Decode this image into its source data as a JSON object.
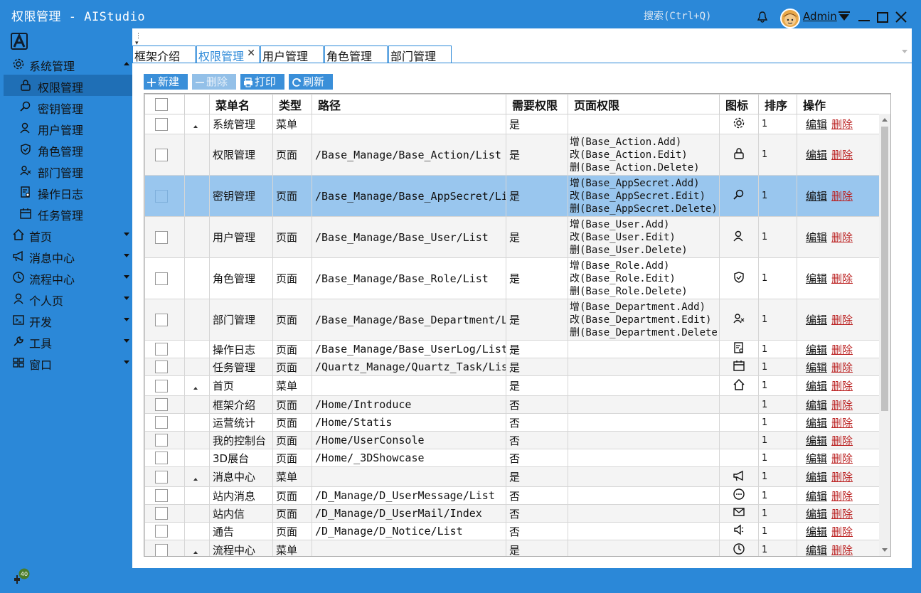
{
  "window": {
    "title": "权限管理 - AIStudio",
    "search_placeholder": "搜索(Ctrl+Q)",
    "user": "Admin",
    "notify_badge": "40"
  },
  "colors": {
    "accent": "#2b88d8",
    "selected_row": "#99c6ee",
    "delete_link": "#b22222"
  },
  "sidebar": {
    "groups": [
      {
        "label": "系统管理",
        "icon": "gear-icon",
        "expanded": true,
        "items": [
          {
            "label": "权限管理",
            "icon": "lock-icon",
            "active": true
          },
          {
            "label": "密钥管理",
            "icon": "key-search-icon"
          },
          {
            "label": "用户管理",
            "icon": "user-icon"
          },
          {
            "label": "角色管理",
            "icon": "shield-icon"
          },
          {
            "label": "部门管理",
            "icon": "group-icon"
          },
          {
            "label": "操作日志",
            "icon": "log-icon"
          },
          {
            "label": "任务管理",
            "icon": "calendar-icon"
          }
        ]
      },
      {
        "label": "首页",
        "icon": "home-icon"
      },
      {
        "label": "消息中心",
        "icon": "megaphone-icon"
      },
      {
        "label": "流程中心",
        "icon": "clock-icon"
      },
      {
        "label": "个人页",
        "icon": "person-icon"
      },
      {
        "label": "开发",
        "icon": "terminal-icon"
      },
      {
        "label": "工具",
        "icon": "wrench-icon"
      },
      {
        "label": "窗口",
        "icon": "windows-icon"
      }
    ]
  },
  "tabs": [
    {
      "label": "框架介绍"
    },
    {
      "label": "权限管理",
      "active": true
    },
    {
      "label": "用户管理"
    },
    {
      "label": "角色管理"
    },
    {
      "label": "部门管理"
    }
  ],
  "toolbar": {
    "new": "新建",
    "delete": "删除",
    "print": "打印",
    "refresh": "刷新"
  },
  "table": {
    "columns": [
      "菜单名",
      "类型",
      "路径",
      "需要权限",
      "页面权限",
      "图标",
      "排序",
      "操作"
    ],
    "edit_label": "编辑",
    "delete_label": "删除",
    "rows": [
      {
        "tree": true,
        "name": "系统管理",
        "type": "菜单",
        "path": "",
        "need": "是",
        "perms": [],
        "icon": "gear-icon",
        "order": "1"
      },
      {
        "name": "权限管理",
        "type": "页面",
        "path": "/Base_Manage/Base_Action/List",
        "need": "是",
        "perms": [
          "增(Base_Action.Add)",
          "改(Base_Action.Edit)",
          "删(Base_Action.Delete)"
        ],
        "icon": "lock-icon",
        "order": "1"
      },
      {
        "selected": true,
        "name": "密钥管理",
        "type": "页面",
        "path": "/Base_Manage/Base_AppSecret/List",
        "need": "是",
        "perms": [
          "增(Base_AppSecret.Add)",
          "改(Base_AppSecret.Edit)",
          "删(Base_AppSecret.Delete)"
        ],
        "icon": "key-search-icon",
        "order": "1"
      },
      {
        "name": "用户管理",
        "type": "页面",
        "path": "/Base_Manage/Base_User/List",
        "need": "是",
        "perms": [
          "增(Base_User.Add)",
          "改(Base_User.Edit)",
          "删(Base_User.Delete)"
        ],
        "icon": "user-icon",
        "order": "1"
      },
      {
        "name": "角色管理",
        "type": "页面",
        "path": "/Base_Manage/Base_Role/List",
        "need": "是",
        "perms": [
          "增(Base_Role.Add)",
          "改(Base_Role.Edit)",
          "删(Base_Role.Delete)"
        ],
        "icon": "shield-icon",
        "order": "1"
      },
      {
        "name": "部门管理",
        "type": "页面",
        "path": "/Base_Manage/Base_Department/List",
        "need": "是",
        "perms": [
          "增(Base_Department.Add)",
          "改(Base_Department.Edit)",
          "删(Base_Department.Delete)"
        ],
        "icon": "group-icon",
        "order": "1"
      },
      {
        "name": "操作日志",
        "type": "页面",
        "path": "/Base_Manage/Base_UserLog/List",
        "need": "是",
        "perms": [],
        "icon": "log-icon",
        "order": "1"
      },
      {
        "name": "任务管理",
        "type": "页面",
        "path": "/Quartz_Manage/Quartz_Task/List",
        "need": "是",
        "perms": [],
        "icon": "calendar-icon",
        "order": "1"
      },
      {
        "tree": true,
        "name": "首页",
        "type": "菜单",
        "path": "",
        "need": "是",
        "perms": [],
        "icon": "home-icon",
        "order": "1"
      },
      {
        "name": "框架介绍",
        "type": "页面",
        "path": "/Home/Introduce",
        "need": "否",
        "perms": [],
        "icon": "",
        "order": "1"
      },
      {
        "name": "运营统计",
        "type": "页面",
        "path": "/Home/Statis",
        "need": "否",
        "perms": [],
        "icon": "",
        "order": "1"
      },
      {
        "name": "我的控制台",
        "type": "页面",
        "path": "/Home/UserConsole",
        "need": "否",
        "perms": [],
        "icon": "",
        "order": "1"
      },
      {
        "name": "3D展台",
        "type": "页面",
        "path": "/Home/_3DShowcase",
        "need": "否",
        "perms": [],
        "icon": "",
        "order": "1"
      },
      {
        "tree": true,
        "name": "消息中心",
        "type": "菜单",
        "path": "",
        "need": "是",
        "perms": [],
        "icon": "megaphone-icon",
        "order": "1"
      },
      {
        "name": "站内消息",
        "type": "页面",
        "path": "/D_Manage/D_UserMessage/List",
        "need": "否",
        "perms": [],
        "icon": "chat-icon",
        "order": "1"
      },
      {
        "name": "站内信",
        "type": "页面",
        "path": "/D_Manage/D_UserMail/Index",
        "need": "否",
        "perms": [],
        "icon": "mail-icon",
        "order": "1"
      },
      {
        "name": "通告",
        "type": "页面",
        "path": "/D_Manage/D_Notice/List",
        "need": "否",
        "perms": [],
        "icon": "speaker-icon",
        "order": "1"
      },
      {
        "tree": true,
        "name": "流程中心",
        "type": "菜单",
        "path": "",
        "need": "是",
        "perms": [],
        "icon": "clock-icon",
        "order": "1"
      }
    ]
  }
}
